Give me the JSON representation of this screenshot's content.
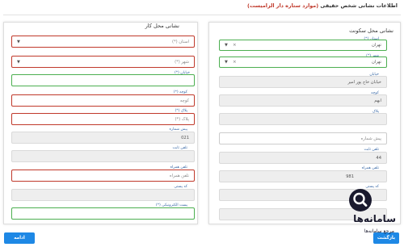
{
  "header": {
    "title": "اطلاعات نشانی شخص حقیقی",
    "required_note": "(موارد ستاره دار الزامیست)"
  },
  "residence": {
    "title": "نشانی محل سکونت",
    "province": {
      "label": "استان (*)",
      "value": "تهران"
    },
    "city": {
      "label": "شهر (*)",
      "value": "تهران"
    },
    "street": {
      "label": "خیابان",
      "value": "خیابان خاج پور امیر"
    },
    "alley": {
      "label": "کوچه",
      "value": "ابهم"
    },
    "plaque": {
      "label": "پلاک",
      "value": ""
    },
    "preline": {
      "label": "",
      "placeholder": "پیش شماره"
    },
    "phone": {
      "label": "تلفن ثابت",
      "value": "44"
    },
    "mobile": {
      "label": "تلفن همراه",
      "value": "981"
    },
    "postal": {
      "label": "کد پستی",
      "value": ""
    },
    "email": {
      "label": "",
      "value": ""
    }
  },
  "work": {
    "title": "نشانی محل کار",
    "province": {
      "label": "",
      "placeholder": "استان (*)"
    },
    "city": {
      "label": "",
      "placeholder": "شهر (*)"
    },
    "street": {
      "label": "خیابان (*)",
      "value": ""
    },
    "alley": {
      "label": "کوچه (*)",
      "placeholder": "کوچه"
    },
    "plaque": {
      "label": "پلاک (*)",
      "placeholder": "پلاک (*)"
    },
    "preline": {
      "label": "پیش شماره",
      "value": "021"
    },
    "phone": {
      "label": "تلفن ثابت",
      "value": ""
    },
    "mobile": {
      "label": "تلفن همراه",
      "placeholder": "تلفن همراه"
    },
    "postal": {
      "label": "کد پستی",
      "value": ""
    },
    "email": {
      "label": "پست الکترونیکی (*)",
      "value": ""
    }
  },
  "buttons": {
    "next": "ادامه",
    "prev": "بازگشت"
  },
  "watermark": {
    "text": "سامانه‌ها",
    "sub": "مرجع سامانه‌ها"
  },
  "icons": {
    "dropdown": "chevron-down-icon",
    "clear": "close-icon",
    "logo": "search-icon"
  },
  "colors": {
    "required_border": "#c0392b",
    "valid_border": "#4caf50",
    "button": "#1e88e5",
    "required_text": "#c0392b"
  }
}
